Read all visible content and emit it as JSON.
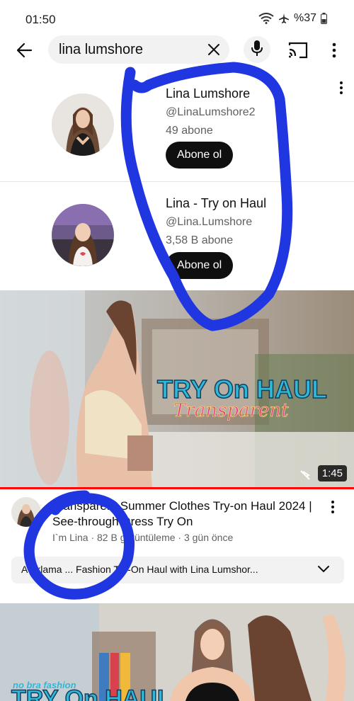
{
  "status_bar": {
    "time": "01:50",
    "battery": "%37"
  },
  "search": {
    "query": "lina lumshore"
  },
  "channels": [
    {
      "name": "Lina Lumshore",
      "handle": "@LinaLumshore2",
      "subscribers": "49 abone",
      "button": "Abone ol"
    },
    {
      "name": "Lina - Try on Haul",
      "handle": "@Lina.Lumshore",
      "subscribers": "3,58 B abone",
      "button": "Abone ol"
    }
  ],
  "video": {
    "thumbnail_title": "TRY On HAUL",
    "thumbnail_subtitle": "Transparent",
    "duration": "1:45",
    "title": "Transparent Summer Clothes Try-on Haul 2024 | See-through Dress Try On",
    "meta": "I`m Lina · 82 B görüntüleme · 3 gün önce",
    "description": "Açıklama ... Fashion Try-On Haul with Lina Lumshor..."
  },
  "video2": {
    "thumbnail_label_top": "no bra fashion",
    "thumbnail_title": "TRY On HAUL"
  },
  "colors": {
    "accent": "#ff0000",
    "annotation": "#1f36e0",
    "button_bg": "#0f0f0f"
  }
}
